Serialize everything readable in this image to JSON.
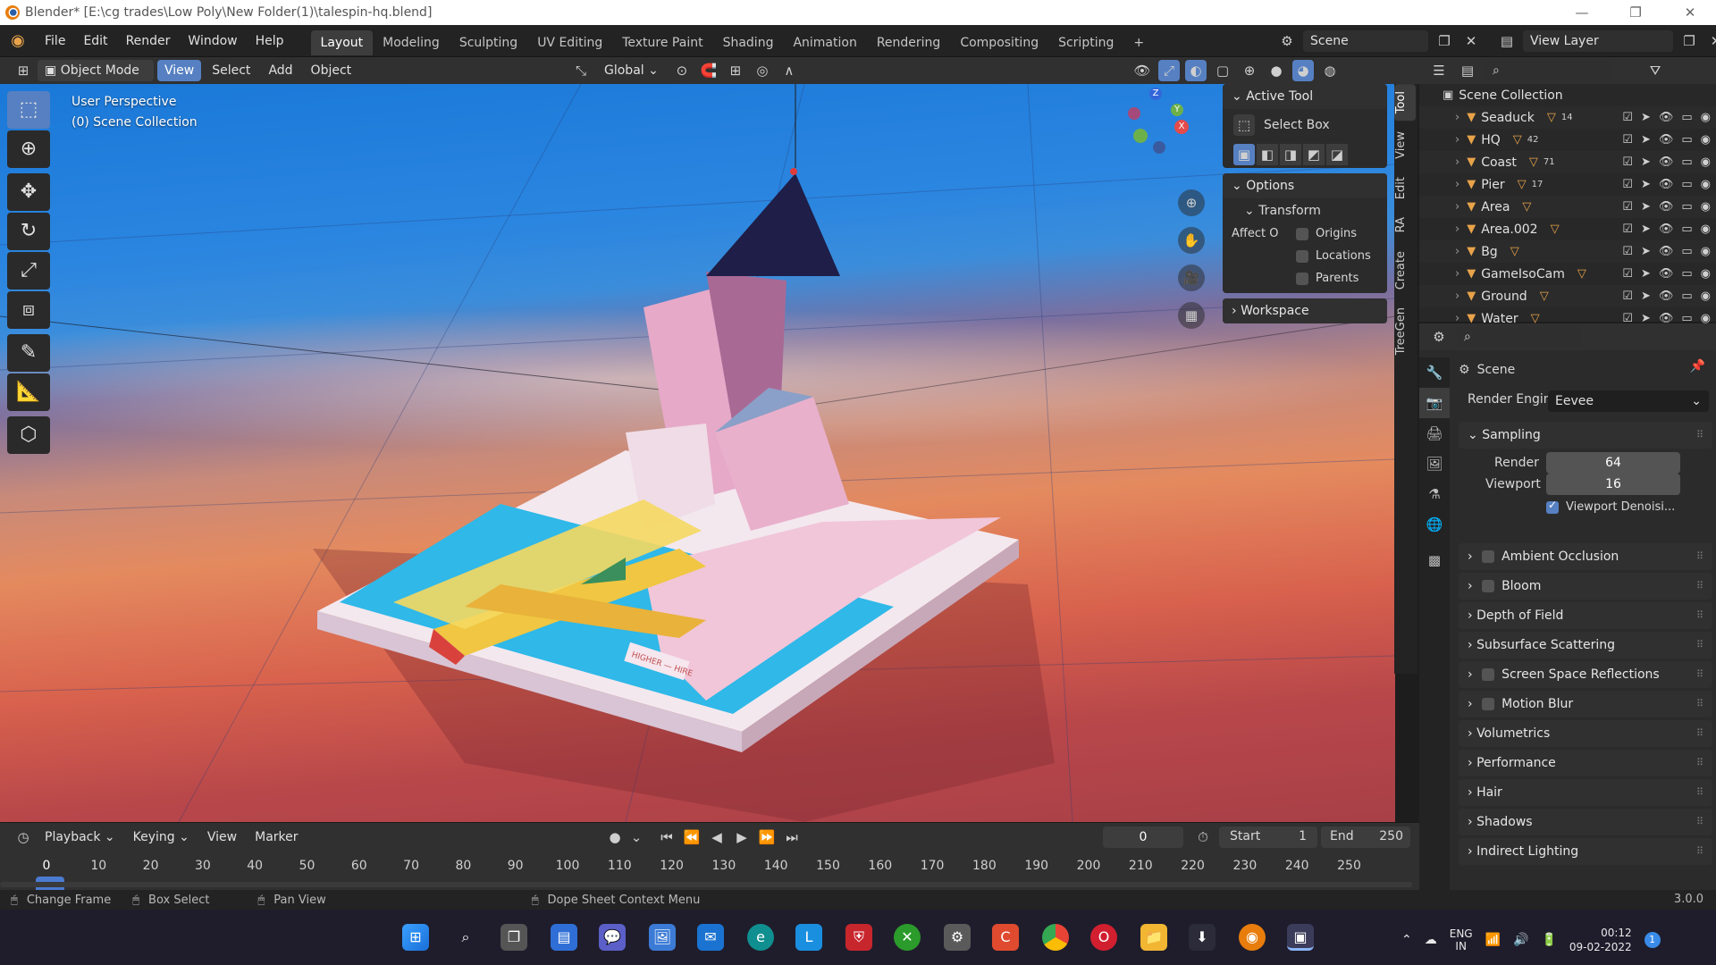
{
  "window": {
    "title": "Blender* [E:\\cg trades\\Low Poly\\New Folder(1)\\talespin-hq.blend]",
    "controls": [
      "—",
      "❐",
      "✕"
    ]
  },
  "menubar": {
    "menus": [
      "File",
      "Edit",
      "Render",
      "Window",
      "Help"
    ],
    "workspaces": [
      "Layout",
      "Modeling",
      "Sculpting",
      "UV Editing",
      "Texture Paint",
      "Shading",
      "Animation",
      "Rendering",
      "Compositing",
      "Scripting"
    ],
    "active_workspace": "Layout",
    "add_tab": "+",
    "scene": "Scene",
    "view_layer": "View Layer"
  },
  "viewport_header": {
    "mode": "Object Mode",
    "menus": [
      "View",
      "Select",
      "Add",
      "Object"
    ],
    "active_menu": "View",
    "transform_orientation": "Global"
  },
  "viewport": {
    "perspective": "User Perspective",
    "collection": "(0) Scene Collection",
    "gizmo_axes": [
      "X",
      "Y",
      "Z"
    ],
    "sign_text": "HIGHER — HIRE"
  },
  "npanel": {
    "active_tool_header": "Active Tool",
    "tool_name": "Select Box",
    "options_header": "Options",
    "transform_header": "Transform",
    "affect_label": "Affect O",
    "affect_options": [
      {
        "label": "Origins",
        "checked": false
      },
      {
        "label": "Locations",
        "checked": false
      },
      {
        "label": "Parents",
        "checked": false
      }
    ],
    "workspace_header": "Workspace",
    "tabs": [
      "Tool",
      "View",
      "Edit",
      "RA",
      "Create",
      "TreeGen"
    ]
  },
  "outliner": {
    "root": "Scene Collection",
    "items": [
      {
        "name": "Seaduck",
        "badge": "14"
      },
      {
        "name": "HQ",
        "badge": "42"
      },
      {
        "name": "Coast",
        "badge": "71"
      },
      {
        "name": "Pier",
        "badge": "17"
      },
      {
        "name": "Area",
        "badge": ""
      },
      {
        "name": "Area.002",
        "badge": ""
      },
      {
        "name": "Bg",
        "badge": ""
      },
      {
        "name": "GameIsoCam",
        "badge": ""
      },
      {
        "name": "Ground",
        "badge": ""
      },
      {
        "name": "Water",
        "badge": ""
      }
    ]
  },
  "properties": {
    "context": "Scene",
    "render_engine_label": "Render Engine",
    "render_engine": "Eevee",
    "sampling": "Sampling",
    "render_label": "Render",
    "render_samples": "64",
    "viewport_label": "Viewport",
    "viewport_samples": "16",
    "viewport_denoise": "Viewport Denoisi...",
    "sections": [
      {
        "label": "Ambient Occlusion",
        "checkbox": true
      },
      {
        "label": "Bloom",
        "checkbox": true
      },
      {
        "label": "Depth of Field",
        "checkbox": false
      },
      {
        "label": "Subsurface Scattering",
        "checkbox": false
      },
      {
        "label": "Screen Space Reflections",
        "checkbox": true
      },
      {
        "label": "Motion Blur",
        "checkbox": true
      },
      {
        "label": "Volumetrics",
        "checkbox": false
      },
      {
        "label": "Performance",
        "checkbox": false
      },
      {
        "label": "Hair",
        "checkbox": false
      },
      {
        "label": "Shadows",
        "checkbox": false
      },
      {
        "label": "Indirect Lighting",
        "checkbox": false
      }
    ]
  },
  "timeline": {
    "menus": [
      "Playback",
      "Keying",
      "View",
      "Marker"
    ],
    "current_frame": "0",
    "start_label": "Start",
    "start": "1",
    "end_label": "End",
    "end": "250",
    "ticks": [
      "0",
      "10",
      "20",
      "30",
      "40",
      "50",
      "60",
      "70",
      "80",
      "90",
      "100",
      "110",
      "120",
      "130",
      "140",
      "150",
      "160",
      "170",
      "180",
      "190",
      "200",
      "210",
      "220",
      "230",
      "240",
      "250"
    ]
  },
  "statusbar": {
    "hints": [
      "Change Frame",
      "Box Select",
      "Pan View",
      "Dope Sheet Context Menu"
    ],
    "version": "3.0.0"
  },
  "taskbar": {
    "lang": "ENG",
    "region": "IN",
    "time": "00:12",
    "date": "09-02-2022",
    "notifications": "1"
  }
}
